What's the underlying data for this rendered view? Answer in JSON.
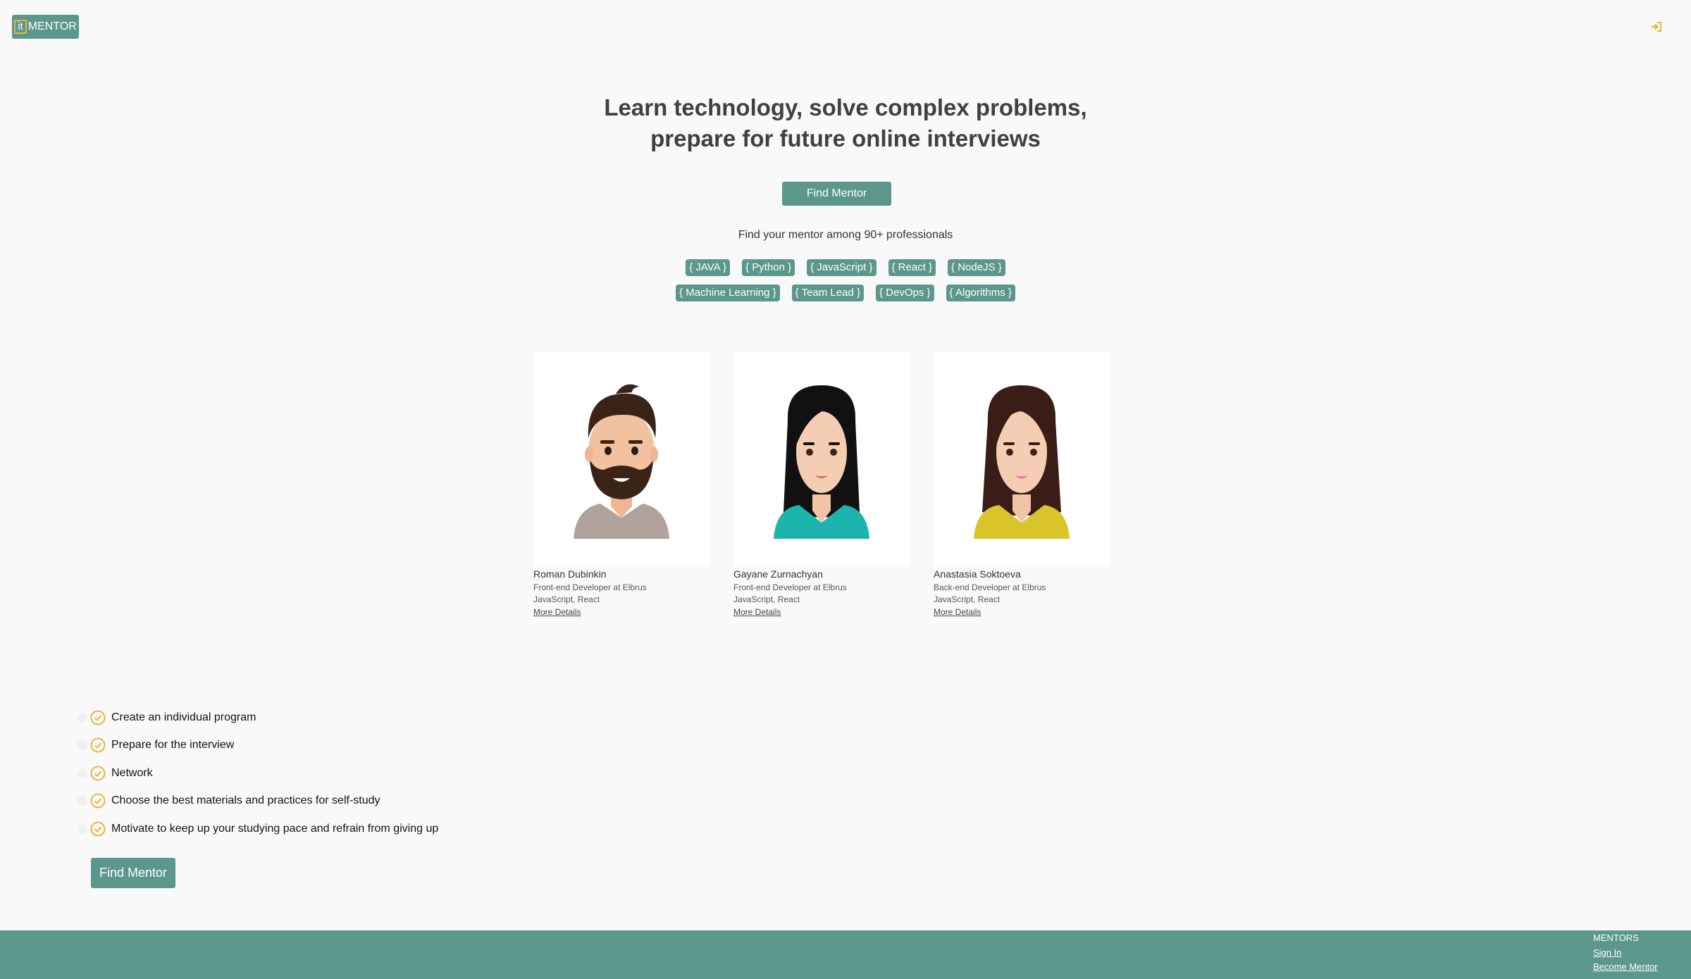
{
  "header": {
    "logo_it": "it",
    "logo_text": "MENTOR",
    "signin_icon": "sign-in-icon"
  },
  "hero": {
    "title_line1": "Learn technology, solve complex problems,",
    "title_line2": "prepare for future online interviews",
    "button": "Find Mentor",
    "among": "Find your mentor among 90+ professionals"
  },
  "tags_row1": [
    "{ JAVA }",
    "{ Python }",
    "{ JavaScript }",
    "{ React }",
    "{ NodeJS }"
  ],
  "tags_row2": [
    "{ Machine Learning }",
    "{ Team Lead }",
    "{ DevOps }",
    "{ Algorithms }"
  ],
  "mentors": [
    {
      "name": "Roman Dubinkin",
      "role": "Front-end Developer at Elbrus",
      "skills": "JavaScript, React",
      "more": "More Details"
    },
    {
      "name": "Gayane Zurnachyan",
      "role": "Front-end Developer at Elbrus",
      "skills": "JavaScript, React",
      "more": "More Details"
    },
    {
      "name": "Anastasia Soktoeva",
      "role": "Back-end Developer at Elbrus",
      "skills": "JavaScript, React",
      "more": "More Details"
    }
  ],
  "benefits": [
    "Create an individual program",
    "Prepare for the interview",
    "Network",
    "Choose the best materials and practices for self-study",
    "Motivate to keep up your studying pace and refrain from giving up"
  ],
  "bottom_button": "Find Mentor",
  "footer": {
    "heading": "MENTORS",
    "sign_in": "Sign In",
    "become_mentor": "Become Mentor"
  },
  "colors": {
    "accent": "#5b978b",
    "check": "#e8b53a",
    "background": "#f9f9f9"
  }
}
